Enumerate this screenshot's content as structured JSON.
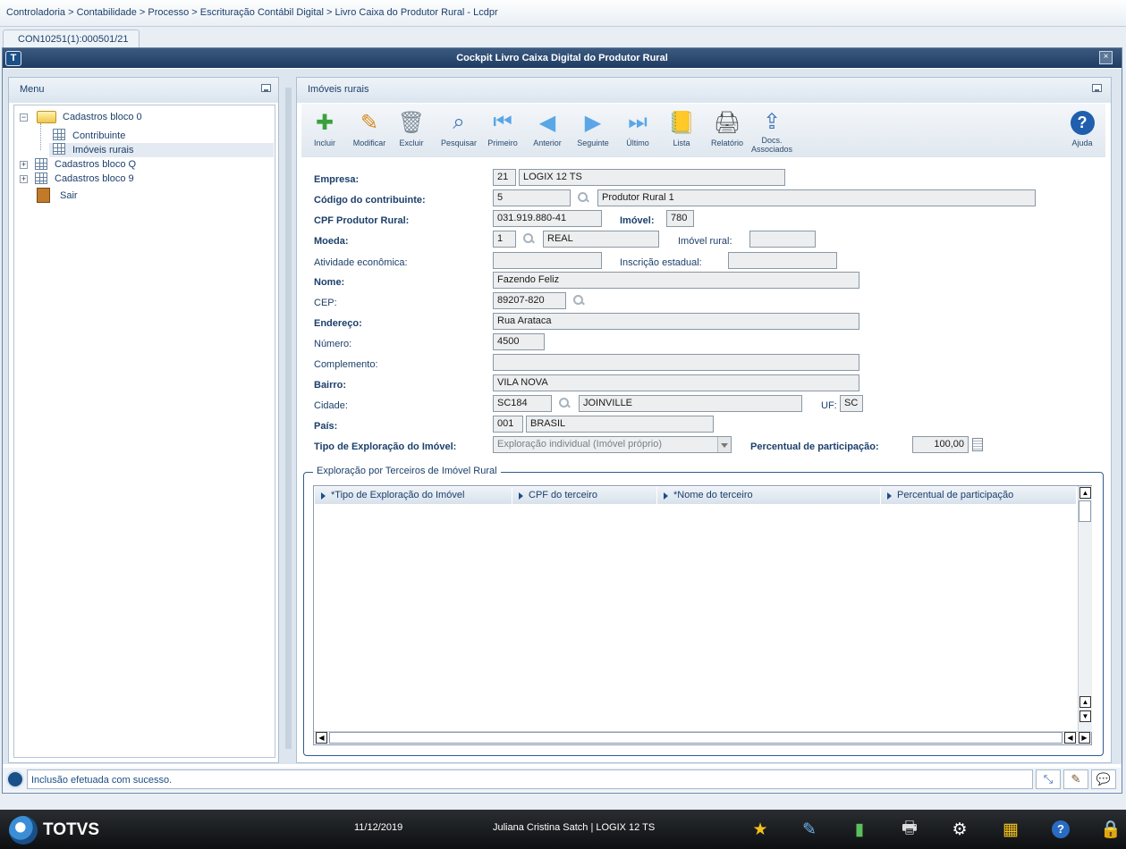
{
  "breadcrumb": "Controladoria > Contabilidade > Processo > Escrituração Contábil Digital > Livro Caixa do Produtor Rural - Lcdpr",
  "tab_label": "CON10251(1):000501/21",
  "window": {
    "title": "Cockpit Livro Caixa Digital do Produtor Rural",
    "close": "×"
  },
  "menu": {
    "title": "Menu",
    "items": [
      {
        "label": "Cadastros bloco 0",
        "expander": "−"
      },
      {
        "label": "Contribuinte"
      },
      {
        "label": "Imóveis rurais"
      },
      {
        "label": "Cadastros bloco Q",
        "expander": "+"
      },
      {
        "label": "Cadastros bloco 9",
        "expander": "+"
      },
      {
        "label": "Sair"
      }
    ]
  },
  "content": {
    "title": "Imóveis rurais",
    "toolbar": [
      {
        "label": "Incluir",
        "icon": "add-icon"
      },
      {
        "label": "Modificar",
        "icon": "edit-icon"
      },
      {
        "label": "Excluir",
        "icon": "delete-icon"
      },
      {
        "label": "Pesquisar",
        "icon": "search-icon"
      },
      {
        "label": "Primeiro",
        "icon": "first-icon"
      },
      {
        "label": "Anterior",
        "icon": "previous-icon"
      },
      {
        "label": "Seguinte",
        "icon": "next-icon"
      },
      {
        "label": "Último",
        "icon": "last-icon"
      },
      {
        "label": "Lista",
        "icon": "list-icon"
      },
      {
        "label": "Relatório",
        "icon": "printer-icon"
      },
      {
        "label": "Docs.",
        "label2": "Associados",
        "icon": "documents-icon"
      },
      {
        "label": "Ajuda",
        "icon": "help-icon"
      }
    ],
    "form": {
      "empresa": {
        "label": "Empresa:",
        "code": "21",
        "name": "LOGIX 12 TS"
      },
      "contribuinte": {
        "label": "Código do contribuinte:",
        "code": "5",
        "name": "Produtor Rural 1"
      },
      "cpf": {
        "label": "CPF Produtor Rural:",
        "value": "031.919.880-41"
      },
      "imovel": {
        "label": "Imóvel:",
        "value": "780"
      },
      "moeda": {
        "label": "Moeda:",
        "code": "1",
        "name": "REAL"
      },
      "imovel_rural": {
        "label": "Imóvel rural:",
        "value": ""
      },
      "atividade": {
        "label": "Atividade econômica:",
        "value": ""
      },
      "inscricao": {
        "label": "Inscrição estadual:",
        "value": ""
      },
      "nome": {
        "label": "Nome:",
        "value": "Fazendo Feliz"
      },
      "cep": {
        "label": "CEP:",
        "value": "89207-820"
      },
      "endereco": {
        "label": "Endereço:",
        "value": "Rua Arataca"
      },
      "numero": {
        "label": "Número:",
        "value": "4500"
      },
      "complemento": {
        "label": "Complemento:",
        "value": ""
      },
      "bairro": {
        "label": "Bairro:",
        "value": "VILA NOVA"
      },
      "cidade": {
        "label": "Cidade:",
        "code": "SC184",
        "name": "JOINVILLE"
      },
      "uf": {
        "label": "UF:",
        "value": "SC"
      },
      "pais": {
        "label": "País:",
        "code": "001",
        "name": "BRASIL"
      },
      "tipo_exploracao": {
        "label": "Tipo de Exploração do Imóvel:",
        "value": "Exploração individual (Imóvel próprio)"
      },
      "percentual": {
        "label": "Percentual de participação:",
        "value": "100,00"
      }
    },
    "group": {
      "title": "Exploração por Terceiros de Imóvel Rural",
      "columns": [
        "*Tipo de Exploração do Imóvel",
        "CPF do terceiro",
        "*Nome do terceiro",
        "Percentual de participação"
      ]
    }
  },
  "status": {
    "message": "Inclusão efetuada com sucesso."
  },
  "taskbar": {
    "brand": "TOTVS",
    "date": "11/12/2019",
    "user": "Juliana Cristina Satch | LOGIX 12 TS"
  },
  "colors": {
    "title_bar": "#1f3c63",
    "taskbar": "#1a1c1f",
    "accent": "#2f5c8f"
  }
}
